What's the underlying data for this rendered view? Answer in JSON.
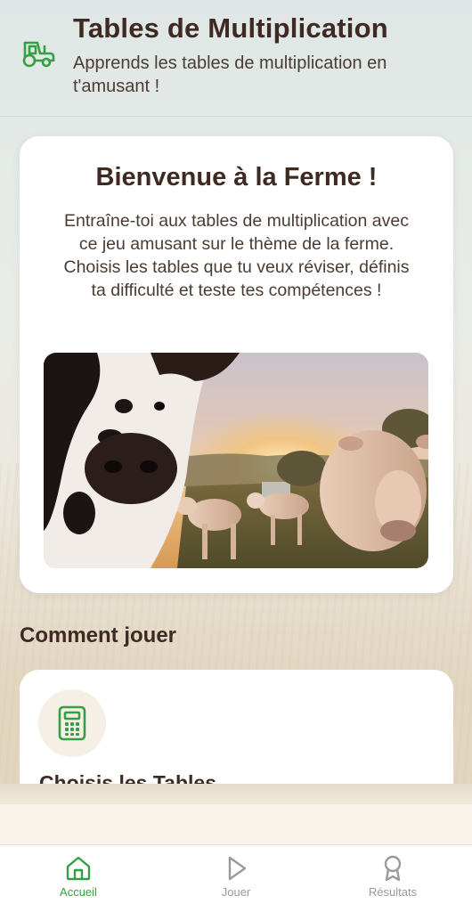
{
  "header": {
    "title": "Tables de Multiplication",
    "subtitle": "Apprends les tables de multiplication en t'amusant !",
    "icon": "tractor-icon"
  },
  "welcome": {
    "title": "Bienvenue à la Ferme !",
    "text": "Entraîne-toi aux tables de multiplication avec ce jeu amusant sur le thème de la ferme. Choisis les tables que tu veux réviser, définis ta difficulté et teste tes compétences !",
    "image": "farm-cows-photo"
  },
  "how_to": {
    "section_title": "Comment jouer",
    "step_title": "Choisis les Tables",
    "step_icon": "calculator-icon"
  },
  "tabs": [
    {
      "label": "Accueil",
      "icon": "home-icon",
      "active": true
    },
    {
      "label": "Jouer",
      "icon": "play-icon",
      "active": false
    },
    {
      "label": "Résultats",
      "icon": "award-icon",
      "active": false
    }
  ],
  "colors": {
    "accent": "#34a043",
    "text_dark": "#3e2a22",
    "inactive": "#9a9a9a"
  }
}
